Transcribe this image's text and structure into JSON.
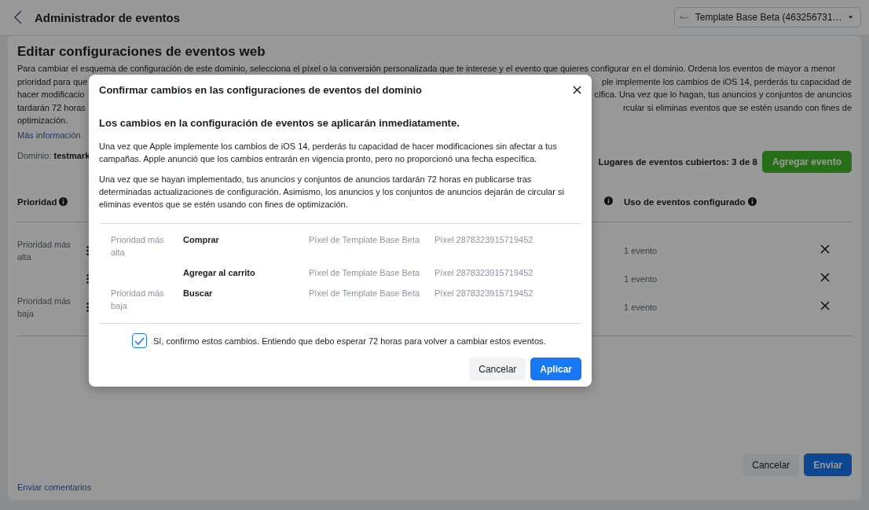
{
  "header": {
    "title": "Administrador de eventos",
    "account": "Template Base Beta (463256731…"
  },
  "page": {
    "title": "Editar configuraciones de eventos web",
    "description_lines": [
      {
        "left": "Para cambiar el esquema de configuración de este dominio, selecciona el píxel o la conversión personalizada que te interese y el evento que quieres configurar en el dominio. Ordena los eventos de mayor a menor"
      },
      {
        "left": "prioridad para que",
        "right": "ple implemente los cambios de iOS 14, perderás tu capacidad de"
      },
      {
        "left": "hacer modificacio",
        "right": "cífica. Una vez que lo hagan, tus anuncios y conjuntos de anuncios"
      },
      {
        "left": "tardarán 72 horas",
        "right": "rcular si eliminas eventos que se estén usando con fines de"
      },
      {
        "left": "optimización."
      }
    ],
    "more_link": "Más información",
    "domain_label": "Dominio:",
    "domain_value": "testmark",
    "slots_text": "Lugares de eventos cubiertos: 3 de 8",
    "add_button": "Agregar evento",
    "columns": [
      {
        "label": "Prioridad"
      },
      {
        "label": "Uso de eventos configurado"
      }
    ],
    "rows": [
      {
        "priority": "Prioridad más alta",
        "usage": "1 evento"
      },
      {
        "usage": "1 evento"
      },
      {
        "priority": "Prioridad más baja",
        "usage": "1 evento"
      }
    ],
    "feedback_link": "Enviar comentarios",
    "cancel_button": "Cancelar",
    "send_button": "Enviar"
  },
  "modal": {
    "title": "Confirmar cambios en las configuraciones de eventos del dominio",
    "headline": "Los cambios en la configuración de eventos se aplicarán inmediatamente.",
    "paragraphs": [
      "Una vez que Apple implemente los cambios de iOS 14, perderás tu capacidad de hacer modificaciones sin afectar a tus campañas. Apple anunció que los cambios entrarán en vigencia pronto, pero no proporcionó una fecha específica.",
      "Una vez que se hayan implementado, tus anuncios y conjuntos de anuncios tardarán 72 horas en publicarse tras determinadas actualizaciones de configuración. Asimismo, los anuncios y los conjuntos de anuncios dejarán de circular si eliminas eventos que se estén usando con fines de optimización."
    ],
    "events": [
      {
        "priority": "Prioridad más alta",
        "event": "Comprar",
        "pixel_name": "Píxel de Template Base Beta",
        "pixel_id": "Píxel 2878323915719452"
      },
      {
        "event": "Agregar al carrito",
        "pixel_name": "Píxel de Template Base Beta",
        "pixel_id": "Píxel 2878323915719452"
      },
      {
        "priority": "Prioridad más baja",
        "event": "Buscar",
        "pixel_name": "Píxel de Template Base Beta",
        "pixel_id": "Píxel 2878323915719452"
      }
    ],
    "confirm": {
      "checked": true,
      "label": "Sí, confirmo estos cambios. Entiendo que debo esperar 72 horas para volver a cambiar estos eventos."
    },
    "cancel_button": "Cancelar",
    "apply_button": "Aplicar"
  }
}
